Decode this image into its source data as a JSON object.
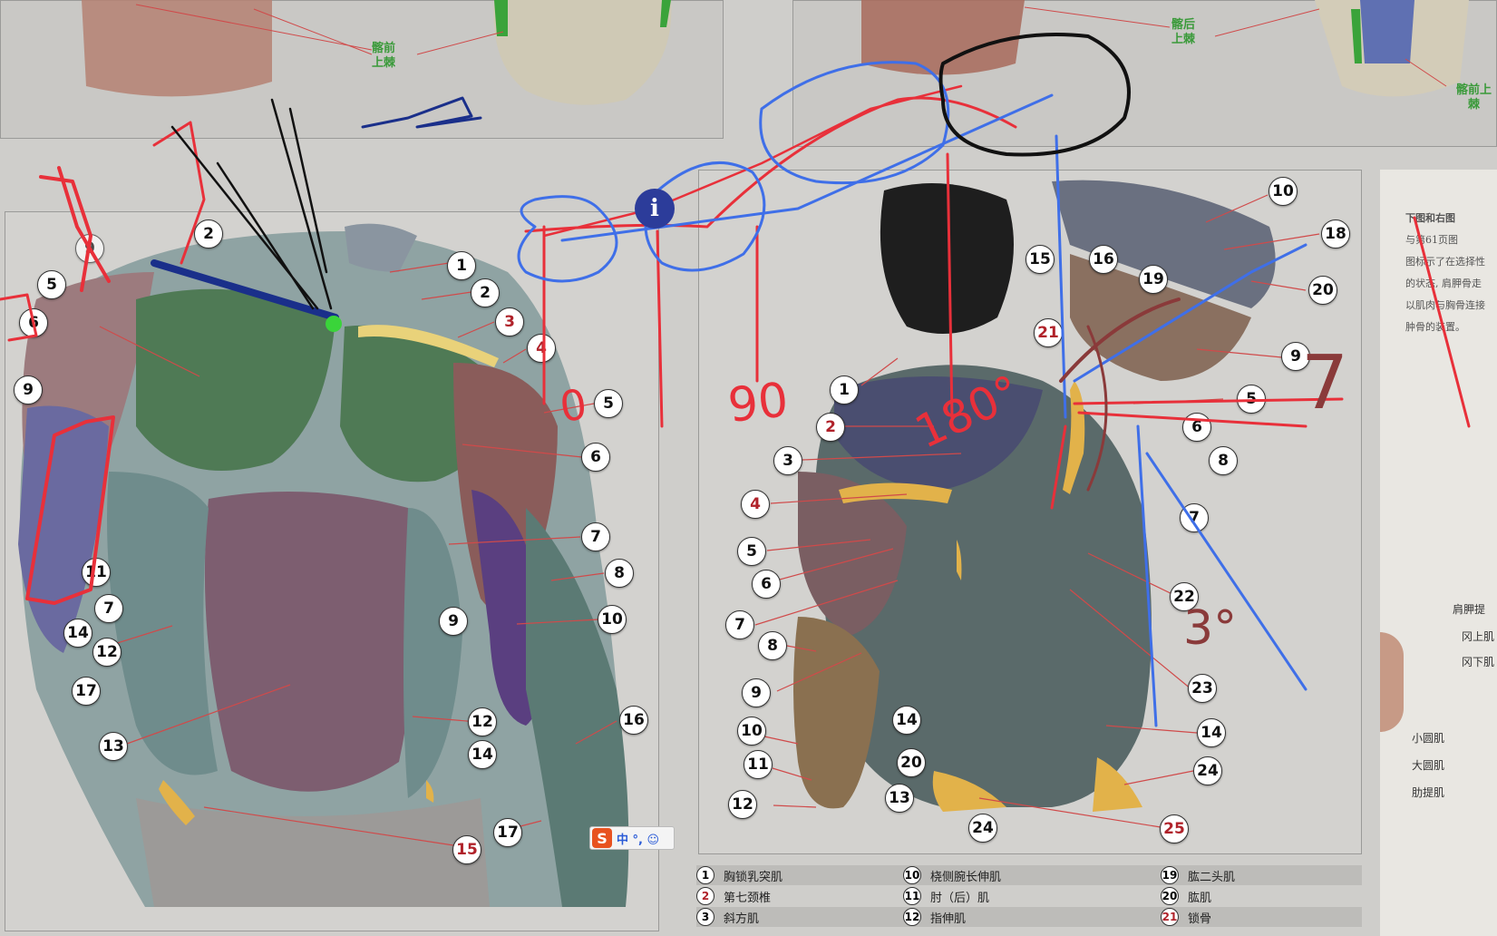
{
  "top_left_note": [
    "髂前",
    "上棘"
  ],
  "top_right_note": [
    "髂后",
    "上棘"
  ],
  "top_far_right_note": "髂前上棘",
  "front_callouts": [
    {
      "n": "1",
      "red": false
    },
    {
      "n": "2",
      "red": false
    },
    {
      "n": "3",
      "red": true
    },
    {
      "n": "4",
      "red": true
    },
    {
      "n": "5",
      "red": false
    },
    {
      "n": "6",
      "red": false
    },
    {
      "n": "7",
      "red": false
    },
    {
      "n": "8",
      "red": false
    },
    {
      "n": "9",
      "red": false
    },
    {
      "n": "10",
      "red": false
    },
    {
      "n": "12",
      "red": false
    },
    {
      "n": "14",
      "red": false
    },
    {
      "n": "16",
      "red": false
    },
    {
      "n": "17",
      "red": false
    },
    {
      "n": "15",
      "red": true
    },
    {
      "n": "2",
      "red": false
    },
    {
      "n": "5",
      "red": false
    },
    {
      "n": "6",
      "red": false
    },
    {
      "n": "9",
      "red": false
    },
    {
      "n": "11",
      "red": false
    },
    {
      "n": "7",
      "red": false
    },
    {
      "n": "14",
      "red": false
    },
    {
      "n": "12",
      "red": false
    },
    {
      "n": "17",
      "red": false
    },
    {
      "n": "13",
      "red": false
    },
    {
      "n": "9",
      "red": false
    }
  ],
  "back_callouts": [
    {
      "n": "10",
      "red": false
    },
    {
      "n": "18",
      "red": false
    },
    {
      "n": "15",
      "red": false
    },
    {
      "n": "16",
      "red": false
    },
    {
      "n": "19",
      "red": false
    },
    {
      "n": "20",
      "red": false
    },
    {
      "n": "21",
      "red": true
    },
    {
      "n": "9",
      "red": false
    },
    {
      "n": "5",
      "red": false
    },
    {
      "n": "6",
      "red": false
    },
    {
      "n": "8",
      "red": false
    },
    {
      "n": "7",
      "red": false
    },
    {
      "n": "1",
      "red": false
    },
    {
      "n": "2",
      "red": true
    },
    {
      "n": "3",
      "red": false
    },
    {
      "n": "4",
      "red": true
    },
    {
      "n": "5",
      "red": false
    },
    {
      "n": "6",
      "red": false
    },
    {
      "n": "7",
      "red": false
    },
    {
      "n": "8",
      "red": false
    },
    {
      "n": "9",
      "red": false
    },
    {
      "n": "10",
      "red": false
    },
    {
      "n": "11",
      "red": false
    },
    {
      "n": "12",
      "red": false
    },
    {
      "n": "14",
      "red": false
    },
    {
      "n": "20",
      "red": false
    },
    {
      "n": "13",
      "red": false
    },
    {
      "n": "24",
      "red": false
    },
    {
      "n": "22",
      "red": false
    },
    {
      "n": "23",
      "red": false
    },
    {
      "n": "14",
      "red": false
    },
    {
      "n": "24",
      "red": false
    },
    {
      "n": "25",
      "red": true
    }
  ],
  "legend": [
    {
      "n": "1",
      "name": "胸锁乳突肌",
      "red": false
    },
    {
      "n": "2",
      "name": "第七颈椎",
      "red": true
    },
    {
      "n": "3",
      "name": "斜方肌",
      "red": false
    },
    {
      "n": "10",
      "name": "桡侧腕长伸肌",
      "red": false
    },
    {
      "n": "11",
      "name": "肘（后）肌",
      "red": false
    },
    {
      "n": "12",
      "name": "指伸肌",
      "red": false
    },
    {
      "n": "19",
      "name": "肱二头肌",
      "red": false
    },
    {
      "n": "20",
      "name": "肱肌",
      "red": false
    },
    {
      "n": "21",
      "name": "锁骨",
      "red": true
    }
  ],
  "annotations": [
    "0",
    "90",
    "180°",
    "3°",
    "7"
  ],
  "ime": {
    "logo": "S",
    "text": "中 °, ☺"
  },
  "info_icon": "i",
  "book": {
    "lines": [
      "下图和右图",
      "与第61页图",
      "图标示了在选择性",
      "的状态, 肩胛骨走",
      "以肌肉与胸骨连接",
      "肿骨的装置。"
    ],
    "labels": [
      "肩胛提",
      "冈上肌",
      "冈下肌",
      "小圆肌",
      "大圆肌",
      "肋提肌"
    ]
  }
}
